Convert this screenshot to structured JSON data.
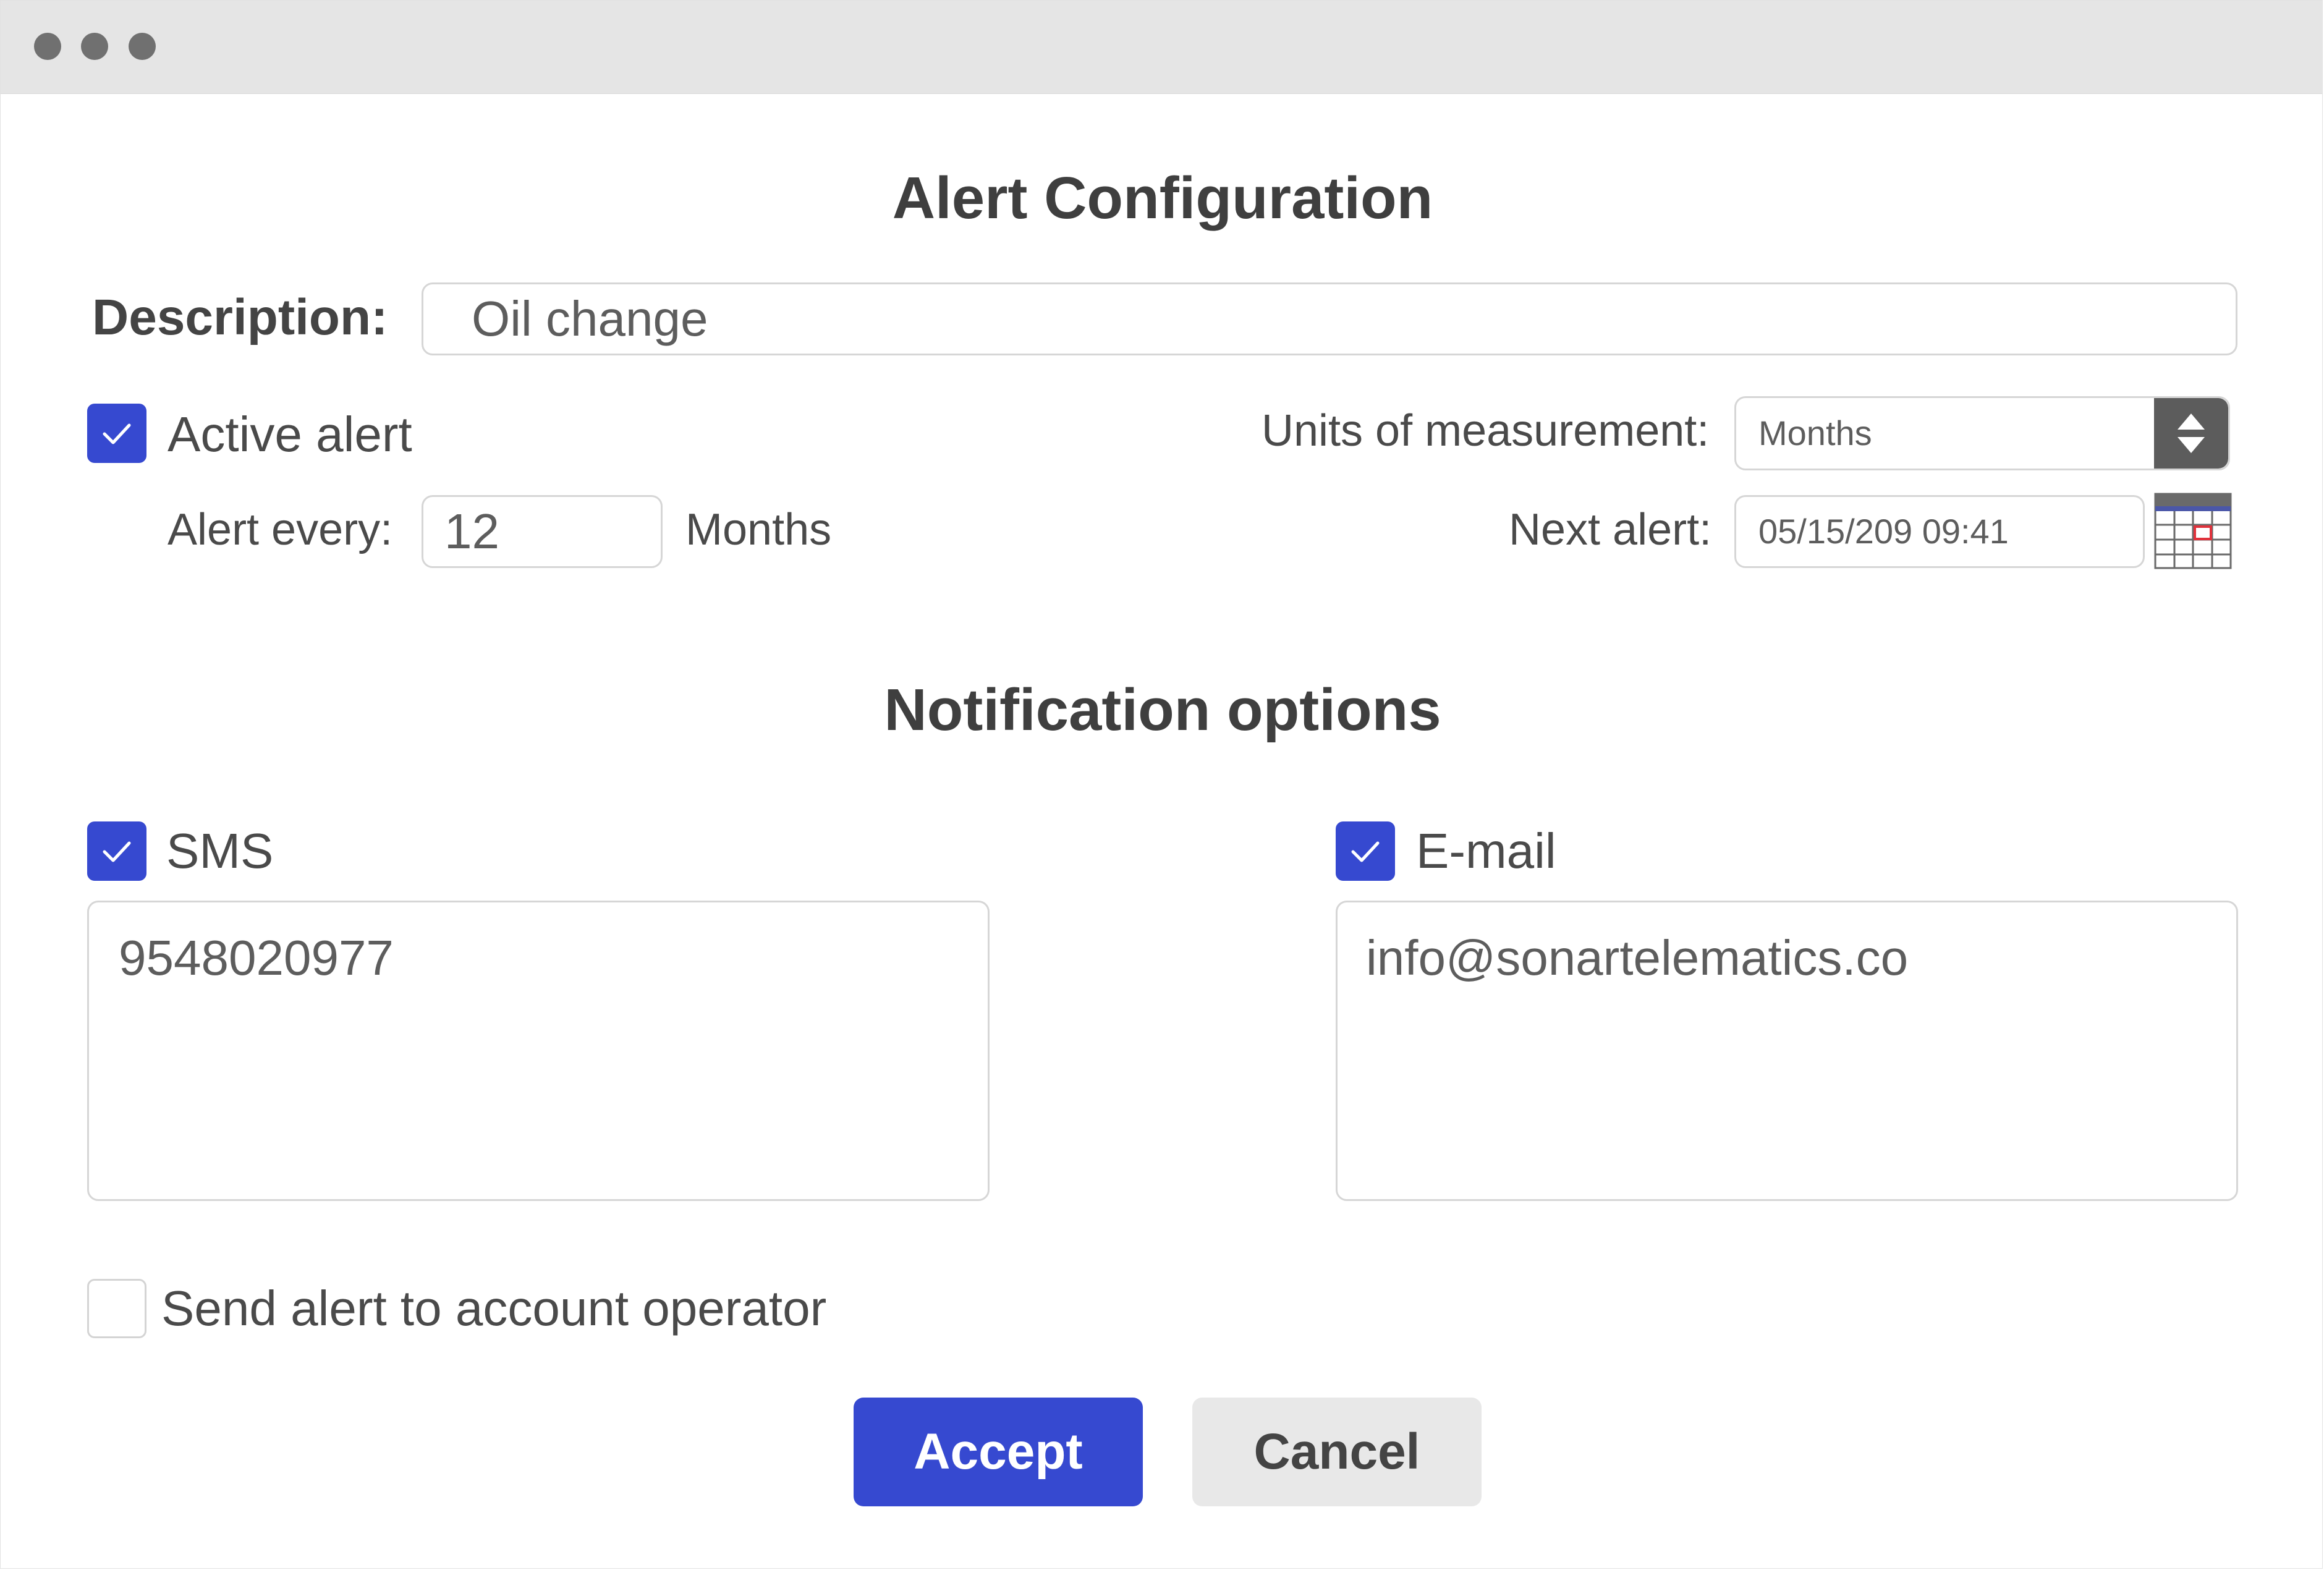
{
  "dialog": {
    "title": "Alert Configuration",
    "description": {
      "label": "Description:",
      "value": "Oil change"
    },
    "active_alert": {
      "label": "Active alert",
      "checked": true
    },
    "units": {
      "label": "Units of measurement:",
      "value": "Months"
    },
    "alert_every": {
      "label": "Alert every:",
      "value": "12",
      "unit": "Months"
    },
    "next_alert": {
      "label": "Next alert:",
      "value": "05/15/209 09:41"
    }
  },
  "notification": {
    "title": "Notification options",
    "sms": {
      "label": "SMS",
      "checked": true,
      "value": "9548020977"
    },
    "email": {
      "label": "E-mail",
      "checked": true,
      "value": "info@sonartelematics.co"
    },
    "send_operator": {
      "label": "Send alert to account operator",
      "checked": false
    }
  },
  "buttons": {
    "accept": "Accept",
    "cancel": "Cancel"
  },
  "colors": {
    "accent": "#3649d0",
    "titlebar": "#e5e5e5",
    "select_button": "#5c5c5c"
  }
}
